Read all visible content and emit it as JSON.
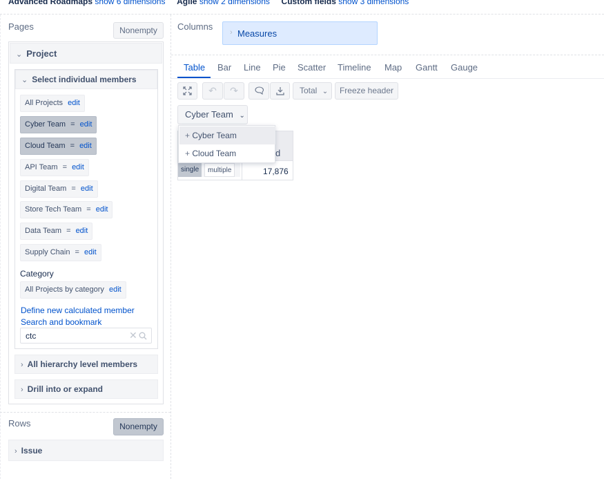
{
  "top_bar": {
    "advanced_roadmaps_label": "Advanced Roadmaps",
    "advanced_roadmaps_link": "show 6 dimensions",
    "agile_label": "Agile",
    "agile_link": "show 2 dimensions",
    "custom_fields_label": "Custom fields",
    "custom_fields_link": "show 3 dimensions"
  },
  "pages": {
    "title": "Pages",
    "nonempty_label": "Nonempty",
    "project_accordion": "Project",
    "select_members_accordion": "Select individual members",
    "members": [
      {
        "label": "All Projects",
        "operator": "",
        "edit": "edit",
        "selected": false
      },
      {
        "label": "Cyber Team",
        "operator": "=",
        "edit": "edit",
        "selected": true
      },
      {
        "label": "Cloud Team",
        "operator": "=",
        "edit": "edit",
        "selected": true
      },
      {
        "label": "API Team",
        "operator": "=",
        "edit": "edit",
        "selected": false
      },
      {
        "label": "Digital Team",
        "operator": "=",
        "edit": "edit",
        "selected": false
      },
      {
        "label": "Store Tech Team",
        "operator": "=",
        "edit": "edit",
        "selected": false
      },
      {
        "label": "Data Team",
        "operator": "=",
        "edit": "edit",
        "selected": false
      },
      {
        "label": "Supply Chain",
        "operator": "=",
        "edit": "edit",
        "selected": false
      }
    ],
    "category_heading": "Category",
    "category_member": {
      "label": "All Projects by category",
      "edit": "edit"
    },
    "define_calculated_link": "Define new calculated member",
    "search_bookmark_link": "Search and bookmark",
    "search_value": "ctc",
    "all_hierarchy_accordion": "All hierarchy level members",
    "drill_accordion": "Drill into or expand"
  },
  "rows": {
    "title": "Rows",
    "nonempty_label": "Nonempty",
    "issue_accordion": "Issue"
  },
  "columns": {
    "title": "Columns",
    "measures_label": "Measures"
  },
  "view_tabs": [
    "Table",
    "Bar",
    "Line",
    "Pie",
    "Scatter",
    "Timeline",
    "Map",
    "Gantt",
    "Gauge"
  ],
  "toolbar": {
    "total_label": "Total",
    "freeze_header_label": "Freeze header"
  },
  "page_filter": {
    "selected": "Cyber Team",
    "options": [
      "Cyber Team",
      "Cloud Team"
    ],
    "mode_single": "single",
    "mode_multiple": "multiple"
  },
  "table": {
    "header_partial": "d",
    "value": "17,876"
  },
  "colors": {
    "link": "#0052cc",
    "selected_member": "#c1c7d0",
    "measures_bg": "#deebff"
  }
}
